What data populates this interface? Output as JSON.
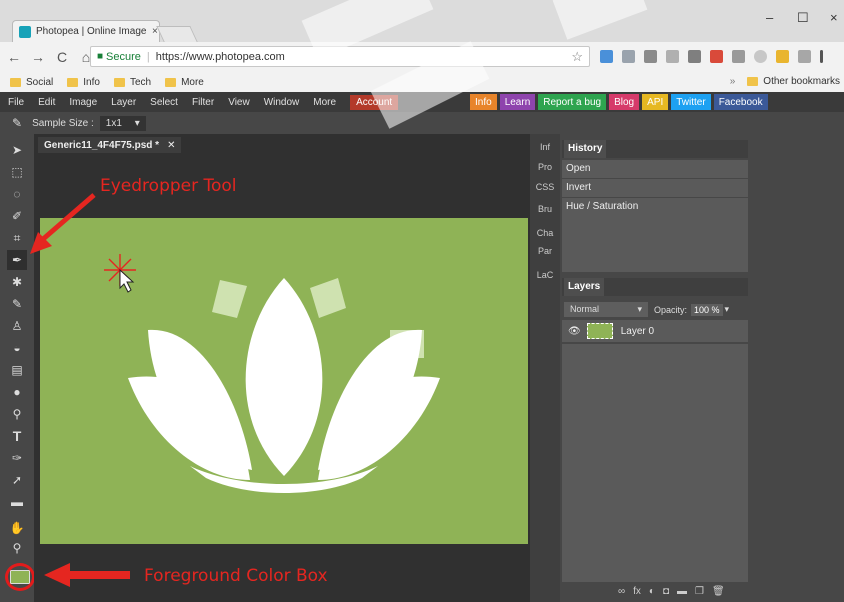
{
  "browser": {
    "tab_title": "Photopea | Online Image",
    "tab_close": "×",
    "window_controls": {
      "minimize": "–",
      "maximize": "☐",
      "close": "×"
    },
    "nav": {
      "back": "←",
      "forward": "→",
      "reload": "C",
      "home": "⌂"
    },
    "secure_label": "Secure",
    "url": "https://www.photopea.com",
    "bookmarks": [
      "Social",
      "Info",
      "Tech",
      "More"
    ],
    "bookmarks_overflow": "»",
    "other_bookmarks": "Other bookmarks"
  },
  "app": {
    "menu": [
      "File",
      "Edit",
      "Image",
      "Layer",
      "Select",
      "Filter",
      "View",
      "Window",
      "More"
    ],
    "account": "Account",
    "links": [
      {
        "label": "Info",
        "color": "#e8842a"
      },
      {
        "label": "Learn",
        "color": "#8e44ad"
      },
      {
        "label": "Report a bug",
        "color": "#2ea44f"
      },
      {
        "label": "Blog",
        "color": "#d63a6a"
      },
      {
        "label": "API",
        "color": "#e6b822"
      },
      {
        "label": "Twitter",
        "color": "#1da1f2"
      },
      {
        "label": "Facebook",
        "color": "#3b5998"
      }
    ],
    "options": {
      "sample_size_label": "Sample Size :",
      "sample_size_value": "1x1",
      "dropdown": "▾"
    },
    "document_tab": "Generic11_4F4F75.psd *",
    "document_close": "✕",
    "collapsed_panels": [
      "Inf",
      "Pro",
      "CSS",
      "Bru",
      "Cha",
      "Par",
      "LaC"
    ],
    "history": {
      "title": "History",
      "items": [
        "Open",
        "Invert",
        "Hue / Saturation"
      ]
    },
    "layers": {
      "title": "Layers",
      "blend_mode": "Normal",
      "opacity_label": "Opacity:",
      "opacity_value": "100 %",
      "layer_name": "Layer 0",
      "footer_icons": [
        "∞",
        "fx",
        "◐",
        "◘",
        "▬",
        "❐",
        "🗑"
      ]
    },
    "canvas_color": "#8fb356"
  },
  "annotations": {
    "eyedropper": "Eyedropper Tool",
    "foreground": "Foreground Color Box",
    "color": "#e52620"
  }
}
